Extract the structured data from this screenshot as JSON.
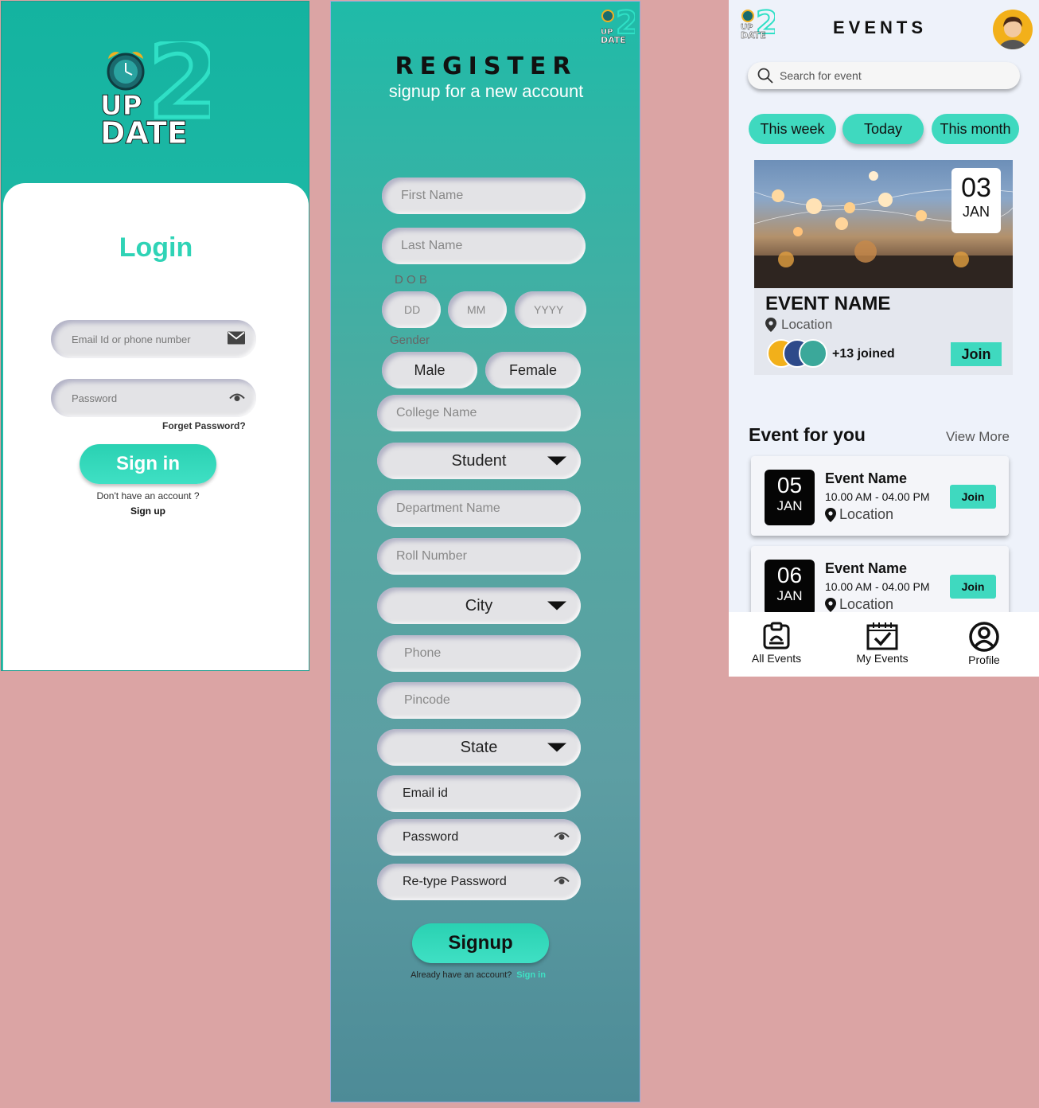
{
  "login": {
    "logo": {
      "up": "UP",
      "date": "DATE"
    },
    "title": "Login",
    "email_placeholder": "Email Id or phone number",
    "password_placeholder": "Password",
    "forget_password": "Forget Password?",
    "signin_label": "Sign in",
    "no_account": "Don't have an account ?",
    "signup_link": "Sign up"
  },
  "register": {
    "logo": {
      "up": "UP",
      "date": "DATE"
    },
    "title": "REGISTER",
    "subtitle": "signup for a new account",
    "first_name": "First Name",
    "last_name": "Last Name",
    "dob_label": "D O B",
    "dd": "DD",
    "mm": "MM",
    "yyyy": "YYYY",
    "gender_label": "Gender",
    "male": "Male",
    "female": "Female",
    "college": "College Name",
    "role_select": "Student",
    "department": "Department Name",
    "roll": "Roll Number",
    "city_select": "City",
    "phone": "Phone",
    "pincode": "Pincode",
    "state_select": "State",
    "email": "Email id",
    "password": "Password",
    "retype": "Re-type Password",
    "signup_label": "Signup",
    "already": "Already have an account?",
    "signin_link": "Sign in"
  },
  "events": {
    "logo": {
      "up": "UP",
      "date": "DATE"
    },
    "title": "EVENTS",
    "search_placeholder": "Search for event",
    "filters": [
      "This week",
      "Today",
      "This month"
    ],
    "featured": {
      "day": "03",
      "month": "JAN",
      "name": "EVENT NAME",
      "location": "Location",
      "joined": "+13 joined",
      "join_label": "Join"
    },
    "section_title": "Event for you",
    "view_more": "View More",
    "cards": [
      {
        "day": "05",
        "month": "JAN",
        "name": "Event Name",
        "time": "10.00 AM - 04.00 PM",
        "location": "Location",
        "join_label": "Join"
      },
      {
        "day": "06",
        "month": "JAN",
        "name": "Event Name",
        "time": "10.00 AM - 04.00 PM",
        "location": "Location",
        "join_label": "Join"
      }
    ],
    "nav": [
      {
        "label": "All Events",
        "icon": "all-events-icon"
      },
      {
        "label": "My Events",
        "icon": "calendar-check-icon"
      },
      {
        "label": "Profile",
        "icon": "profile-icon"
      }
    ]
  },
  "colors": {
    "accent": "#3fd9bf",
    "brand_teal": "#14b3a0",
    "canvas": "#dba4a4"
  }
}
